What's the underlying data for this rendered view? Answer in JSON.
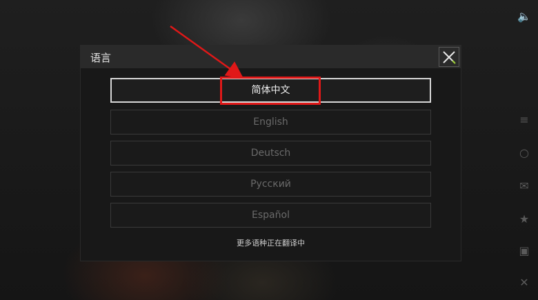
{
  "modal": {
    "title": "语言",
    "languages": [
      {
        "label": "简体中文",
        "selected": true
      },
      {
        "label": "English",
        "selected": false
      },
      {
        "label": "Deutsch",
        "selected": false
      },
      {
        "label": "Русский",
        "selected": false
      },
      {
        "label": "Español",
        "selected": false
      }
    ],
    "footer_note": "更多语种正在翻译中"
  },
  "colors": {
    "annotation": "#e01818",
    "close_accent": "#9acd32"
  }
}
